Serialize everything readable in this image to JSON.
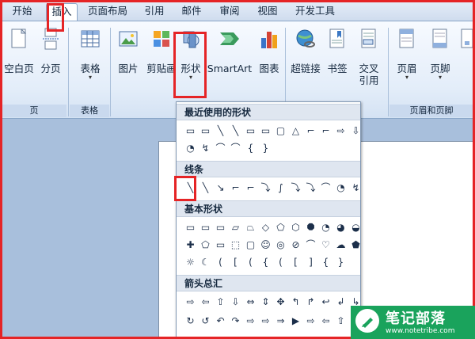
{
  "tabs": [
    {
      "label": "开始",
      "active": false
    },
    {
      "label": "插入",
      "active": true
    },
    {
      "label": "页面布局",
      "active": false
    },
    {
      "label": "引用",
      "active": false
    },
    {
      "label": "邮件",
      "active": false
    },
    {
      "label": "审阅",
      "active": false
    },
    {
      "label": "视图",
      "active": false
    },
    {
      "label": "开发工具",
      "active": false
    }
  ],
  "ribbon": {
    "buttons": {
      "blank_page": "空白页",
      "page_break": "分页",
      "table": "表格",
      "picture": "图片",
      "clip_art": "剪贴画",
      "shapes": "形状",
      "smartart": "SmartArt",
      "chart": "图表",
      "hyperlink": "超链接",
      "bookmark": "书签",
      "cross_ref": "交叉引用",
      "header": "页眉",
      "footer": "页脚"
    },
    "groups": {
      "pages": "页",
      "tables": "表格",
      "header_footer": "页眉和页脚"
    }
  },
  "dropdown": {
    "sections": {
      "recent": "最近使用的形状",
      "lines": "线条",
      "basic": "基本形状",
      "arrows": "箭头总汇"
    },
    "recent_row1": [
      "▭",
      "▭",
      "╲",
      "╲",
      "▭",
      "▭",
      "▢",
      "△",
      "⌐",
      "⌐",
      "⇨",
      "⇩"
    ],
    "recent_row2": [
      "◔",
      "↯",
      "⌒",
      "⌒",
      "{",
      "}"
    ],
    "lines_row": [
      "╲",
      "╲",
      "↘",
      "⌐",
      "⌐",
      "⤵",
      "∫",
      "⤵",
      "⤵",
      "⌒",
      "◔",
      "↯"
    ],
    "basic_row1": [
      "▭",
      "▭",
      "▭",
      "▱",
      "⏢",
      "◇",
      "⬠",
      "⬡",
      "⯃",
      "◔",
      "◕",
      "◒"
    ],
    "basic_row2": [
      "✚",
      "⬠",
      "▭",
      "⬚",
      "▢",
      "☺",
      "◎",
      "⊘",
      "⌒",
      "♡",
      "☁",
      "⬟"
    ],
    "basic_row3": [
      "☼",
      "☾",
      "(",
      "[",
      "(",
      "{",
      "(",
      "[",
      "]",
      "{",
      "}"
    ],
    "arrows_row1": [
      "⇨",
      "⇦",
      "⇧",
      "⇩",
      "⇔",
      "⇕",
      "✥",
      "↰",
      "↱",
      "↩",
      "↲",
      "↳"
    ],
    "arrows_row2": [
      "↻",
      "↺",
      "↶",
      "↷",
      "⇨",
      "⇨",
      "⇒",
      "▶",
      "⇨",
      "⇦",
      "⇧",
      "⇩"
    ]
  },
  "watermark": {
    "title": "笔记部落",
    "url": "www.notetribe.com"
  },
  "colors": {
    "highlight": "#e52426",
    "watermark_bg": "#1aa35c",
    "ribbon_bg": "#e3edf9"
  }
}
